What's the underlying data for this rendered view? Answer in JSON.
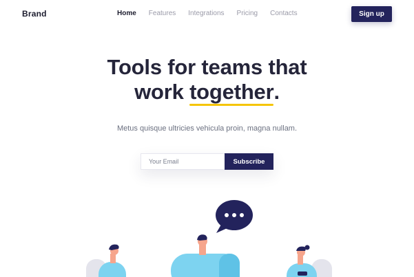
{
  "nav": {
    "brand": "Brand",
    "items": [
      {
        "label": "Home",
        "active": true
      },
      {
        "label": "Features",
        "active": false
      },
      {
        "label": "Integrations",
        "active": false
      },
      {
        "label": "Pricing",
        "active": false
      },
      {
        "label": "Contacts",
        "active": false
      }
    ],
    "signup_label": "Sign up"
  },
  "hero": {
    "title_line1": "Tools for teams that",
    "title_line2_prefix": "work ",
    "title_line2_highlight": "together",
    "title_line2_suffix": ".",
    "subtitle": "Metus quisque ultricies vehicula proin, magna nullam."
  },
  "form": {
    "email_placeholder": "Your Email",
    "subscribe_label": "Subscribe"
  },
  "colors": {
    "primary": "#23235c",
    "highlight": "#f5c400",
    "chair": "#e4e4ec",
    "shirt": "#7dd3f0",
    "skin": "#f6a58c",
    "hair": "#23235c"
  },
  "illustration": {
    "icons": [
      "speech-bubble-icon",
      "person-left",
      "person-center",
      "person-right"
    ]
  }
}
